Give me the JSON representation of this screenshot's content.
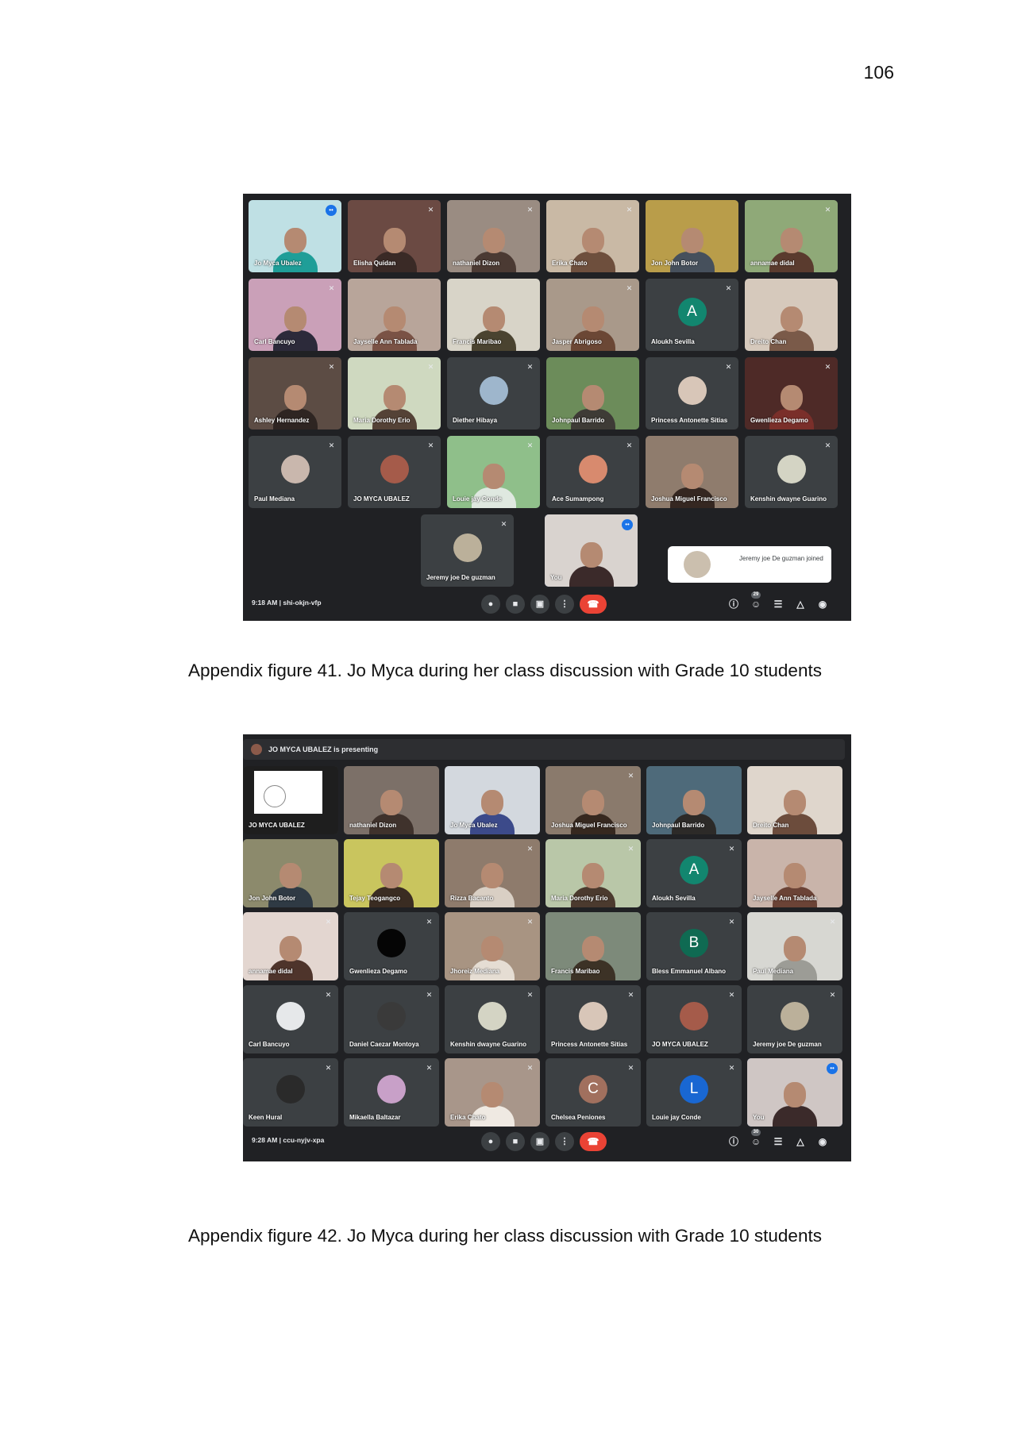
{
  "page_number": "106",
  "figure41": {
    "caption": "Appendix figure 41. Jo Myca during her class discussion with Grade 10 students",
    "meet": {
      "time": "9:18 AM",
      "code": "shi-okjn-vfp",
      "participant_count": "29",
      "toast_text": "Jeremy joe De guzman joined",
      "tiles": [
        {
          "name": "Jo Myca Ubalez",
          "kind": "cam",
          "bg": "#bfe0e4",
          "person": "#1f9e98",
          "speaking": true
        },
        {
          "name": "Elisha Quidan",
          "kind": "cam",
          "bg": "#6b4a43",
          "person": "#3a2a26",
          "muted": true
        },
        {
          "name": "nathaniel Dizon",
          "kind": "cam",
          "bg": "#9a8c82",
          "person": "#4b3a33",
          "muted": true
        },
        {
          "name": "Erika Chato",
          "kind": "cam",
          "bg": "#c9b9a5",
          "person": "#6e4f3d",
          "muted": true
        },
        {
          "name": "Jon John Botor",
          "kind": "cam",
          "bg": "#b99d4a",
          "person": "#46505c",
          "muted": false
        },
        {
          "name": "annamae didal",
          "kind": "cam",
          "bg": "#8fa978",
          "person": "#5a3b2e",
          "muted": true
        },
        {
          "name": "Carl Bancuyo",
          "kind": "cam",
          "bg": "#caa0b8",
          "person": "#2c2a3a",
          "muted": true
        },
        {
          "name": "Jayselle Ann Tablada",
          "kind": "cam",
          "bg": "#b8a59a",
          "person": "#7a5245",
          "muted": false
        },
        {
          "name": "Francis Maribao",
          "kind": "cam",
          "bg": "#d8d4c8",
          "person": "#4a4330",
          "muted": false
        },
        {
          "name": "Jasper Abrigoso",
          "kind": "cam",
          "bg": "#a9998a",
          "person": "#6b4735",
          "muted": true
        },
        {
          "name": "Aloukh Sevilla",
          "kind": "letter",
          "letter": "A",
          "color": "#12866f",
          "muted": true
        },
        {
          "name": "Dreito Chan",
          "kind": "cam",
          "bg": "#d6c9bc",
          "person": "#7a5a49",
          "muted": false
        },
        {
          "name": "Ashley Hernandez",
          "kind": "cam",
          "bg": "#5c4c44",
          "person": "#2e2522",
          "muted": true
        },
        {
          "name": "Maria Dorothy Erio",
          "kind": "cam",
          "bg": "#cfd9c0",
          "person": "#544236",
          "muted": true
        },
        {
          "name": "Diether Hibaya",
          "kind": "avatar",
          "color": "#9eb6cc",
          "muted": true
        },
        {
          "name": "Johnpaul Barrido",
          "kind": "cam",
          "bg": "#6c8c5a",
          "person": "#3e3b36",
          "muted": false
        },
        {
          "name": "Princess Antonette Sitias",
          "kind": "avatar",
          "color": "#d8c6b8",
          "muted": true
        },
        {
          "name": "Gwenlieza Degamo",
          "kind": "cam",
          "bg": "#4e2a27",
          "person": "#7a2f2a",
          "muted": true
        },
        {
          "name": "Paul Mediana",
          "kind": "avatar",
          "color": "#c9b7ad",
          "muted": true
        },
        {
          "name": "JO MYCA UBALEZ",
          "kind": "avatar",
          "color": "#a55b4a",
          "muted": true
        },
        {
          "name": "Louie jay Conde",
          "kind": "cam",
          "bg": "#8fbf8a",
          "person": "#dfe8e0",
          "muted": true
        },
        {
          "name": "Ace Sumampong",
          "kind": "avatar",
          "color": "#d88a6e",
          "muted": true
        },
        {
          "name": "Joshua Miguel Francisco",
          "kind": "cam",
          "bg": "#8f7c6d",
          "person": "#352721",
          "muted": false
        },
        {
          "name": "Kenshin dwayne Guarino",
          "kind": "avatar",
          "color": "#d4d4c4",
          "muted": true
        },
        {
          "name": "Jeremy joe De guzman",
          "kind": "avatar",
          "color": "#bbb09a",
          "muted": true
        },
        {
          "name": "You",
          "kind": "cam",
          "bg": "#d9d3cf",
          "person": "#3b2a2a",
          "self": true,
          "speaking": true
        }
      ]
    }
  },
  "figure42": {
    "caption": "Appendix figure 42. Jo Myca during her class discussion with Grade 10 students",
    "meet": {
      "presenting": "JO MYCA UBALEZ is presenting",
      "time": "9:28 AM",
      "code": "ccu-nyjv-xpa",
      "participant_count": "30",
      "tiles": [
        {
          "name": "JO MYCA UBALEZ",
          "kind": "screen",
          "muted": false
        },
        {
          "name": "nathaniel Dizon",
          "kind": "cam",
          "bg": "#7c7068",
          "person": "#3f322c",
          "muted": false
        },
        {
          "name": "Jo Myca Ubalez",
          "kind": "cam",
          "bg": "#d3d8de",
          "person": "#3c4a8a",
          "muted": false
        },
        {
          "name": "Joshua Miguel Francisco",
          "kind": "cam",
          "bg": "#8a7a6c",
          "person": "#36281f",
          "muted": true
        },
        {
          "name": "Johnpaul Barrido",
          "kind": "cam",
          "bg": "#4e6a7a",
          "person": "#2c2a28",
          "muted": false
        },
        {
          "name": "Dreito Chan",
          "kind": "cam",
          "bg": "#dfd6cc",
          "person": "#6c4c3c",
          "muted": false
        },
        {
          "name": "Jon John Botor",
          "kind": "cam",
          "bg": "#8c8a6c",
          "person": "#2f3a44",
          "muted": false
        },
        {
          "name": "Tejay Teogangco",
          "kind": "cam",
          "bg": "#c9c55e",
          "person": "#3a2c22",
          "muted": false
        },
        {
          "name": "Rizza Bacanto",
          "kind": "cam",
          "bg": "#8e7b6c",
          "person": "#d9cfc4",
          "muted": true
        },
        {
          "name": "Maria Dorothy Erio",
          "kind": "cam",
          "bg": "#b9c7a8",
          "person": "#4b3a2e",
          "muted": true
        },
        {
          "name": "Aloukh Sevilla",
          "kind": "letter",
          "letter": "A",
          "color": "#12866f",
          "muted": true
        },
        {
          "name": "Jayselle Ann Tablada",
          "kind": "cam",
          "bg": "#c9b4aa",
          "person": "#6b4336",
          "muted": false
        },
        {
          "name": "annamae didal",
          "kind": "cam",
          "bg": "#e3d6d0",
          "person": "#4e342b",
          "muted": true
        },
        {
          "name": "Gwenlieza Degamo",
          "kind": "avatar",
          "color": "#050505",
          "muted": true
        },
        {
          "name": "Jhoreiz Mediana",
          "kind": "cam",
          "bg": "#a89482",
          "person": "#e5ddd3",
          "muted": true
        },
        {
          "name": "Francis Maribao",
          "kind": "cam",
          "bg": "#7d8a7a",
          "person": "#3c3226",
          "muted": false
        },
        {
          "name": "Bless Emmanuel Albano",
          "kind": "letter",
          "letter": "B",
          "color": "#0f6a52",
          "muted": true
        },
        {
          "name": "Paul Mediana",
          "kind": "cam",
          "bg": "#d7d7d2",
          "person": "#9c9c96",
          "muted": true
        },
        {
          "name": "Carl Bancuyo",
          "kind": "avatar",
          "color": "#e6e8ea",
          "muted": true
        },
        {
          "name": "Daniel Caezar Montoya",
          "kind": "avatar",
          "color": "#3a3a3a",
          "muted": true
        },
        {
          "name": "Kenshin dwayne Guarino",
          "kind": "avatar",
          "color": "#d4d4c4",
          "muted": true
        },
        {
          "name": "Princess Antonette Sitias",
          "kind": "avatar",
          "color": "#d8c6b8",
          "muted": true
        },
        {
          "name": "JO MYCA UBALEZ",
          "kind": "avatar",
          "color": "#a55b4a",
          "muted": true
        },
        {
          "name": "Jeremy joe De guzman",
          "kind": "avatar",
          "color": "#bbb09a",
          "muted": true
        },
        {
          "name": "Keen Hural",
          "kind": "avatar",
          "color": "#2a2a2a",
          "muted": true
        },
        {
          "name": "Mikaella Baltazar",
          "kind": "avatar",
          "color": "#c8a0c8",
          "muted": true
        },
        {
          "name": "Erika Chato",
          "kind": "cam",
          "bg": "#a8968a",
          "person": "#efe9e2",
          "muted": true
        },
        {
          "name": "Chelsea Peniones",
          "kind": "letter",
          "letter": "C",
          "color": "#a1705e",
          "muted": true
        },
        {
          "name": "Louie jay Conde",
          "kind": "letter",
          "letter": "L",
          "color": "#1967d2",
          "muted": true
        },
        {
          "name": "You",
          "kind": "cam",
          "bg": "#cfc6c4",
          "person": "#3b2a2a",
          "self": true,
          "speaking": true
        }
      ]
    }
  }
}
